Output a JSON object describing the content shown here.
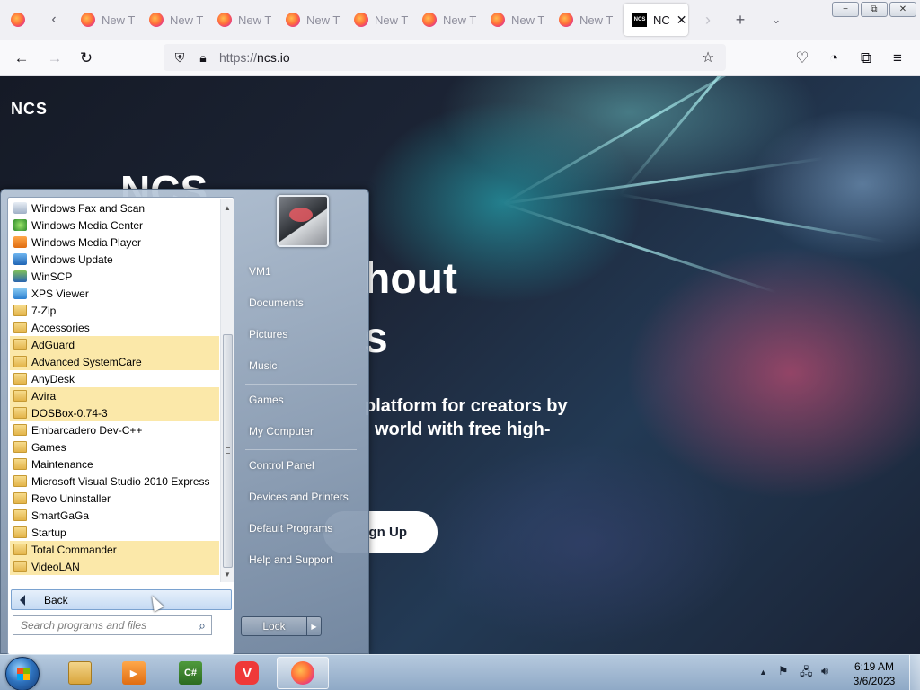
{
  "browser": {
    "tabs": [
      {
        "label": "New T"
      },
      {
        "label": "New T"
      },
      {
        "label": "New T"
      },
      {
        "label": "New T"
      },
      {
        "label": "New T"
      },
      {
        "label": "New T"
      },
      {
        "label": "New T"
      },
      {
        "label": "New T"
      }
    ],
    "active_tab": {
      "label": "NC",
      "favicon": "NCS"
    },
    "url_scheme": "https://",
    "url_host": "ncs.io"
  },
  "page": {
    "logo": "NCS",
    "hero_big": "NCS",
    "hero_line1": "hout",
    "hero_line2": "s",
    "hero_sub1": "platform for creators by",
    "hero_sub2": "world with free high-",
    "signup_label": "gn Up"
  },
  "start_menu": {
    "programs": [
      {
        "label": "Windows Fax and Scan",
        "icon": "fax-icon",
        "highlight": false
      },
      {
        "label": "Windows Media Center",
        "icon": "media-center-icon",
        "highlight": false
      },
      {
        "label": "Windows Media Player",
        "icon": "media-player-icon",
        "highlight": false
      },
      {
        "label": "Windows Update",
        "icon": "windows-update-icon",
        "highlight": false
      },
      {
        "label": "WinSCP",
        "icon": "winscp-icon",
        "highlight": false
      },
      {
        "label": "XPS Viewer",
        "icon": "xps-viewer-icon",
        "highlight": false
      },
      {
        "label": "7-Zip",
        "icon": "folder-icon",
        "highlight": false
      },
      {
        "label": "Accessories",
        "icon": "folder-icon",
        "highlight": false
      },
      {
        "label": "AdGuard",
        "icon": "folder-icon",
        "highlight": true
      },
      {
        "label": "Advanced SystemCare",
        "icon": "folder-icon",
        "highlight": true
      },
      {
        "label": "AnyDesk",
        "icon": "folder-icon",
        "highlight": false
      },
      {
        "label": "Avira",
        "icon": "folder-icon",
        "highlight": true
      },
      {
        "label": "DOSBox-0.74-3",
        "icon": "folder-icon",
        "highlight": true
      },
      {
        "label": "Embarcadero Dev-C++",
        "icon": "folder-icon",
        "highlight": false
      },
      {
        "label": "Games",
        "icon": "folder-icon",
        "highlight": false
      },
      {
        "label": "Maintenance",
        "icon": "folder-icon",
        "highlight": false
      },
      {
        "label": "Microsoft Visual Studio 2010 Express",
        "icon": "folder-icon",
        "highlight": false
      },
      {
        "label": "Revo Uninstaller",
        "icon": "folder-icon",
        "highlight": false
      },
      {
        "label": "SmartGaGa",
        "icon": "folder-icon",
        "highlight": false
      },
      {
        "label": "Startup",
        "icon": "folder-icon",
        "highlight": false
      },
      {
        "label": "Total Commander",
        "icon": "folder-icon",
        "highlight": true
      },
      {
        "label": "VideoLAN",
        "icon": "folder-icon",
        "highlight": true
      }
    ],
    "back_label": "Back",
    "search_placeholder": "Search programs and files",
    "right_items": [
      "VM1",
      "Documents",
      "Pictures",
      "Music",
      "Games",
      "My Computer",
      "Control Panel",
      "Devices and Printers",
      "Default Programs",
      "Help and Support"
    ],
    "lock_label": "Lock"
  },
  "taskbar": {
    "apps": [
      "explorer-icon",
      "media-player-icon",
      "csharp-icon",
      "vivaldi-icon",
      "firefox-icon"
    ],
    "time": "6:19 AM",
    "date": "3/6/2023"
  },
  "colors": {
    "highlight": "#fbe8a9",
    "taskbar": "#9fb6cf"
  }
}
